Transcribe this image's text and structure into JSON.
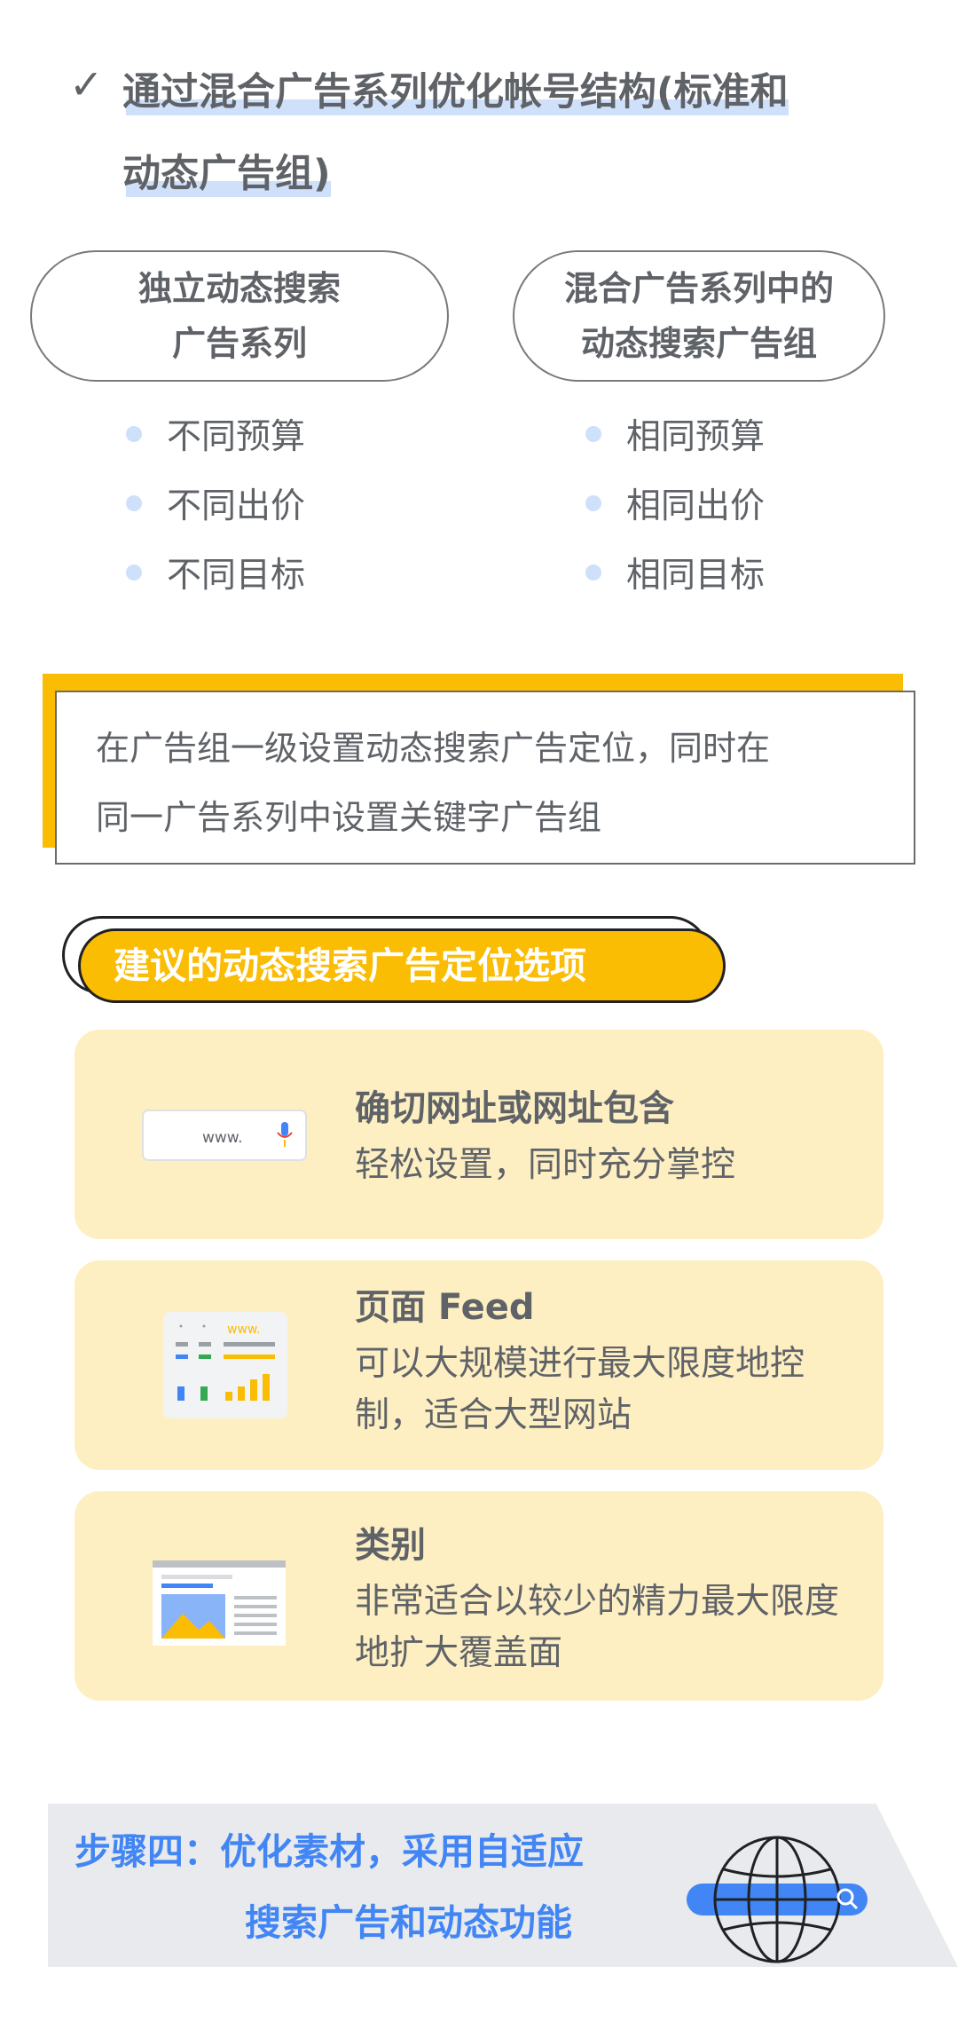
{
  "heading": {
    "check": "✓",
    "line1": "通过混合广告系列优化帐号结构(标准和",
    "line2": "动态广告组)"
  },
  "left_column": {
    "title": "独立动态搜索\n广告系列",
    "bullets": [
      "不同预算",
      "不同出价",
      "不同目标"
    ]
  },
  "right_column": {
    "title": "混合广告系列中的\n动态搜索广告组",
    "bullets": [
      "相同预算",
      "相同出价",
      "相同目标"
    ]
  },
  "note": {
    "line1": "在广告组一级设置动态搜索广告定位，同时在",
    "line2": "同一广告系列中设置关键字广告组"
  },
  "section_title": "建议的动态搜索广告定位选项",
  "cards": [
    {
      "title": "确切网址或网址包含",
      "desc": "轻松设置，同时充分掌控",
      "icon": "url-bar-icon",
      "icon_text": "www."
    },
    {
      "title": "页面 Feed",
      "desc": "可以大规模进行最大限度地控制，适合大型网站",
      "icon": "page-feed-icon",
      "icon_text": "www."
    },
    {
      "title": "类别",
      "desc": "非常适合以较少的精力最大限度地扩大覆盖面",
      "icon": "category-page-icon"
    }
  ],
  "footer": {
    "line1": "步骤四：优化素材，采用自适应",
    "line2": "搜索广告和动态功能",
    "icon": "globe-search-icon"
  },
  "colors": {
    "accent_yellow": "#fbbc04",
    "card_bg": "#feefc3",
    "highlight_blue": "#cfe0fb",
    "brand_blue": "#4285f4",
    "text_gray": "#5f6368"
  }
}
